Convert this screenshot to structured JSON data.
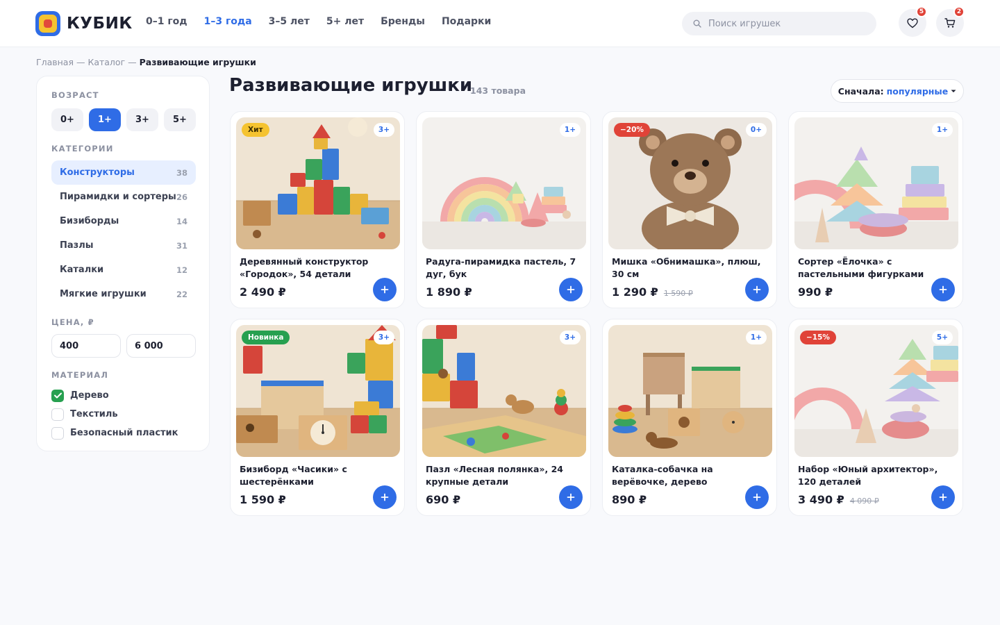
{
  "header": {
    "logo_text": "КУБИК",
    "nav": [
      "0–1 год",
      "1–3 года",
      "3–5 лет",
      "5+ лет",
      "Бренды",
      "Подарки"
    ],
    "nav_active_index": 1,
    "search_placeholder": "Поиск игрушек",
    "favorites_count": "5",
    "cart_count": "2"
  },
  "breadcrumb": {
    "items": [
      "Главная",
      "Каталог"
    ],
    "separator": " — ",
    "current": "Развивающие игрушки"
  },
  "sidebar": {
    "age_title": "ВОЗРАСТ",
    "ages": [
      "0+",
      "1+",
      "3+",
      "5+"
    ],
    "age_active_index": 1,
    "categories_title": "КАТЕГОРИИ",
    "categories": [
      {
        "label": "Конструкторы",
        "count": "38"
      },
      {
        "label": "Пирамидки и сортеры",
        "count": "26"
      },
      {
        "label": "Бизиборды",
        "count": "14"
      },
      {
        "label": "Пазлы",
        "count": "31"
      },
      {
        "label": "Каталки",
        "count": "12"
      },
      {
        "label": "Мягкие игрушки",
        "count": "22"
      }
    ],
    "category_active_index": 0,
    "price_title": "ЦЕНА, ₽",
    "price_from": "400",
    "price_to": "6 000",
    "material_title": "МАТЕРИАЛ",
    "materials": [
      {
        "label": "Дерево",
        "checked": true
      },
      {
        "label": "Текстиль",
        "checked": false
      },
      {
        "label": "Безопасный пластик",
        "checked": false
      }
    ]
  },
  "main": {
    "title": "Развивающие игрушки",
    "count": "143 товара",
    "sort_label": "Сначала:",
    "sort_value": "популярные"
  },
  "products": [
    {
      "title": "Деревянный конструктор «Городок», 54 детали",
      "price": "2 490 ₽",
      "old_price": "",
      "tag": "Хит",
      "tag_color": "#f5c330",
      "tag_text_color": "#3a2d00",
      "age": "3+",
      "scene": "blocks"
    },
    {
      "title": "Радуга-пирамидка пастель, 7 дуг, бук",
      "price": "1 890 ₽",
      "old_price": "",
      "tag": "",
      "tag_color": "",
      "tag_text_color": "",
      "age": "1+",
      "scene": "rainbow"
    },
    {
      "title": "Мишка «Обнимашка», плюш, 30 см",
      "price": "1 290 ₽",
      "old_price": "1 590 ₽",
      "tag": "−20%",
      "tag_color": "#e04338",
      "tag_text_color": "#ffffff",
      "age": "0+",
      "scene": "bear"
    },
    {
      "title": "Сортер «Ёлочка» с пастельными фигурками",
      "price": "990 ₽",
      "old_price": "",
      "tag": "",
      "tag_color": "",
      "tag_text_color": "",
      "age": "1+",
      "scene": "sorter"
    },
    {
      "title": "Бизиборд «Часики» с шестерёнками",
      "price": "1 590 ₽",
      "old_price": "",
      "tag": "Новинка",
      "tag_color": "#27a050",
      "tag_text_color": "#ffffff",
      "age": "3+",
      "scene": "busyboard"
    },
    {
      "title": "Пазл «Лесная полянка», 24 крупные детали",
      "price": "690 ₽",
      "old_price": "",
      "tag": "",
      "tag_color": "",
      "tag_text_color": "",
      "age": "3+",
      "scene": "puzzle"
    },
    {
      "title": "Каталка-собачка на верёвочке, дерево",
      "price": "890 ₽",
      "old_price": "",
      "tag": "",
      "tag_color": "",
      "tag_text_color": "",
      "age": "1+",
      "scene": "dog"
    },
    {
      "title": "Набор «Юный архитектор», 120 деталей",
      "price": "3 490 ₽",
      "old_price": "4 090 ₽",
      "tag": "−15%",
      "tag_color": "#e04338",
      "tag_text_color": "#ffffff",
      "age": "5+",
      "scene": "architect"
    }
  ],
  "icons": {
    "search": "search-icon",
    "favorites": "heart-icon",
    "cart": "cart-icon",
    "sort": "chevron-down-icon",
    "add": "plus-icon",
    "check": "check-icon"
  },
  "colors": {
    "accent": "#2f6ce6",
    "success": "#27a050",
    "sale": "#e04338",
    "hit": "#f5c330"
  }
}
